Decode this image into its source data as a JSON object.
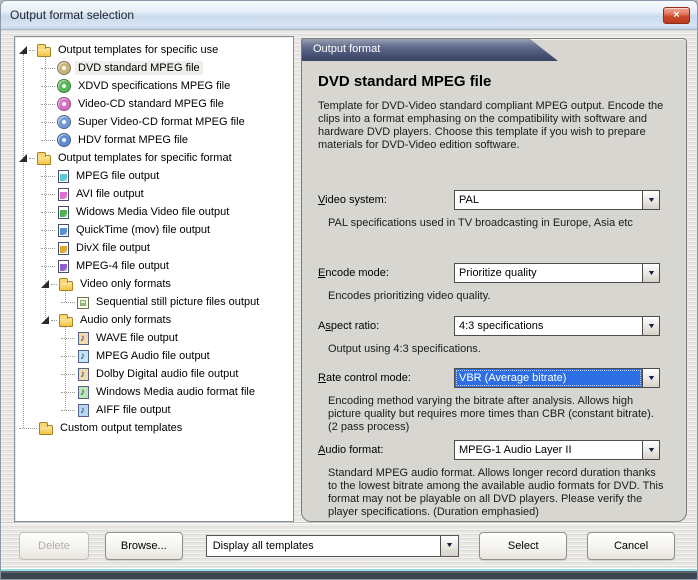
{
  "window": {
    "title": "Output format selection",
    "close_glyph": "×"
  },
  "colors": {
    "selection_blue": "#2d6fe3",
    "tab_navy": "#444f71",
    "folder_yellow": "#f3c443",
    "titlebar_blue": "#c9daec",
    "close_red": "#cd4a2b"
  },
  "tree": {
    "items": [
      {
        "label": "Output templates for specific use",
        "icon": "folder-icon",
        "indent": 0,
        "expander": true,
        "selected": false
      },
      {
        "label": "DVD standard MPEG file",
        "icon": "disc-icon",
        "color": "#c9b478",
        "indent": 1,
        "expander": false,
        "selected": true
      },
      {
        "label": "XDVD specifications MPEG file",
        "icon": "disc-icon",
        "color": "#55b855",
        "indent": 1,
        "expander": false,
        "selected": false
      },
      {
        "label": "Video-CD standard MPEG file",
        "icon": "disc-icon",
        "color": "#d86ec8",
        "indent": 1,
        "expander": false,
        "selected": false
      },
      {
        "label": "Super Video-CD format MPEG file",
        "icon": "disc-icon",
        "color": "#6e9ad8",
        "indent": 1,
        "expander": false,
        "selected": false
      },
      {
        "label": "HDV format MPEG file",
        "icon": "disc-icon",
        "color": "#5c8cd2",
        "indent": 1,
        "expander": false,
        "selected": false
      },
      {
        "label": "Output templates for specific format",
        "icon": "folder-icon",
        "indent": 0,
        "expander": true,
        "selected": false
      },
      {
        "label": "MPEG file output",
        "icon": "file-icon",
        "color": "#5cc8d8",
        "indent": 1,
        "expander": false,
        "selected": false
      },
      {
        "label": "AVI file output",
        "icon": "file-icon",
        "color": "#e070d0",
        "indent": 1,
        "expander": false,
        "selected": false
      },
      {
        "label": "Widows Media Video file output",
        "icon": "file-icon",
        "color": "#4cb44c",
        "indent": 1,
        "expander": false,
        "selected": false
      },
      {
        "label": "QuickTime (mov) file output",
        "icon": "file-icon",
        "color": "#5b8fd6",
        "indent": 1,
        "expander": false,
        "selected": false
      },
      {
        "label": "DivX file output",
        "icon": "file-icon",
        "color": "#e0a830",
        "indent": 1,
        "expander": false,
        "selected": false
      },
      {
        "label": "MPEG-4 file output",
        "icon": "file-icon",
        "color": "#8f5fd0",
        "indent": 1,
        "expander": false,
        "selected": false
      },
      {
        "label": "Video only formats",
        "icon": "folder-icon",
        "indent": 1,
        "expander": true,
        "selected": false
      },
      {
        "label": "Sequential still picture files output",
        "icon": "image-file-icon",
        "color": "#7fc87f",
        "indent": 2,
        "expander": false,
        "selected": false
      },
      {
        "label": "Audio only formats",
        "icon": "folder-icon",
        "indent": 1,
        "expander": true,
        "selected": false
      },
      {
        "label": "WAVE file output",
        "icon": "audio-file-icon",
        "color": "#f2dcab",
        "indent": 2,
        "expander": false,
        "selected": false
      },
      {
        "label": "MPEG Audio file output",
        "icon": "audio-file-icon",
        "color": "#c4e6f2",
        "indent": 2,
        "expander": false,
        "selected": false
      },
      {
        "label": "Dolby Digital audio file output",
        "icon": "audio-file-icon",
        "color": "#f2dcab",
        "indent": 2,
        "expander": false,
        "selected": false
      },
      {
        "label": "Windows Media audio format file",
        "icon": "audio-file-icon",
        "color": "#bce8b4",
        "indent": 2,
        "expander": false,
        "selected": false
      },
      {
        "label": "AIFF file output",
        "icon": "audio-file-icon",
        "color": "#b8d8f0",
        "indent": 2,
        "expander": false,
        "selected": false
      },
      {
        "label": "Custom output templates",
        "icon": "folder-icon",
        "indent": 0,
        "expander": false,
        "selected": false
      }
    ]
  },
  "panel": {
    "tab_label": "Output format",
    "title": "DVD standard MPEG file",
    "description": "Template for DVD-Video standard compliant MPEG output. Encode the clips into a format emphasing on the compatibility with software and hardware DVD players. Choose this template if you wish to prepare materials for DVD-Video edition software.",
    "fields": [
      {
        "label": "Video system:",
        "accel": 0,
        "value": "PAL",
        "selected": false,
        "caption": "PAL specifications used in TV broadcasting in Europe, Asia etc"
      },
      {
        "label": "Encode mode:",
        "accel": 0,
        "value": "Prioritize quality",
        "selected": false,
        "caption": "Encodes prioritizing video quality."
      },
      {
        "label": "Aspect ratio:",
        "accel": 1,
        "value": "4:3 specifications",
        "selected": false,
        "caption": "Output using 4:3 specifications."
      },
      {
        "label": "Rate control mode:",
        "accel": 0,
        "value": "VBR (Average bitrate)",
        "selected": true,
        "caption": "Encoding method varying the bitrate after analysis. Allows high picture quality but requires more times than CBR (constant bitrate). (2 pass process)"
      },
      {
        "label": "Audio format:",
        "accel": 0,
        "value": "MPEG-1 Audio Layer II",
        "selected": false,
        "caption": "Standard MPEG audio format. Allows longer record duration thanks to the lowest bitrate among the available audio formats for DVD. This format may not be playable on all DVD players. Please verify the player specifications. (Duration emphasied)"
      }
    ]
  },
  "footer": {
    "delete_label": "Delete",
    "browse_label": "Browse...",
    "filter_value": "Display all templates",
    "select_label": "Select",
    "cancel_label": "Cancel"
  }
}
